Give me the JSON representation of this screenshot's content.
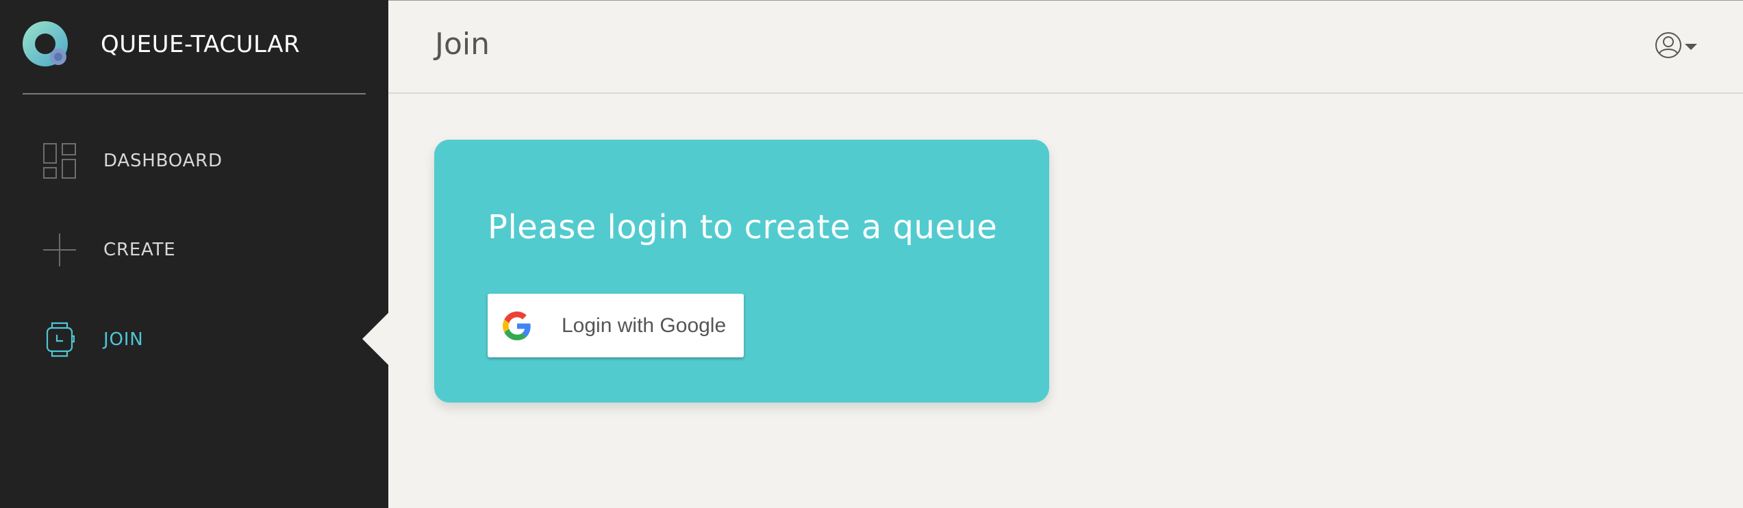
{
  "brand": {
    "name": "QUEUE-TACULAR",
    "logo_icon": "queue-logo-icon"
  },
  "sidebar": {
    "items": [
      {
        "label": "DASHBOARD",
        "icon": "dashboard-grid-icon",
        "active": false
      },
      {
        "label": "CREATE",
        "icon": "plus-icon",
        "active": false
      },
      {
        "label": "JOIN",
        "icon": "watch-icon",
        "active": true
      }
    ]
  },
  "header": {
    "title": "Join",
    "account_icon": "user-circle-icon"
  },
  "card": {
    "message": "Please login to create a queue",
    "login_button_label": "Login with Google",
    "login_button_icon": "google-g-icon"
  },
  "colors": {
    "sidebar_bg": "#222222",
    "accent": "#52cbcf",
    "active_nav": "#4fc6d6",
    "page_bg": "#f3f2ee"
  }
}
